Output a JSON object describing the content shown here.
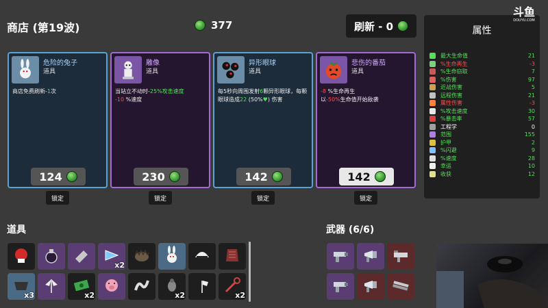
{
  "header": {
    "shop_title": "商店 (第19波)",
    "materials": "377",
    "reroll_label": "刷新 - 0"
  },
  "logo": {
    "mark": "斗鱼",
    "text": "DOUYU.COM"
  },
  "shop_items": [
    {
      "name": "危险的兔子",
      "type": "道具",
      "desc_parts": [
        [
          "商店免费刷新-",
          ""
        ],
        [
          "1",
          "g"
        ],
        [
          "次",
          ""
        ]
      ],
      "price": "124",
      "icon": "rabbit-icon",
      "rarity": "blue"
    },
    {
      "name": "雕像",
      "type": "道具",
      "desc_parts": [
        [
          "当站立不动时-",
          ""
        ],
        [
          "25%攻击速度",
          "g"
        ],
        [
          "\n",
          ""
        ],
        [
          "-10",
          "r"
        ],
        [
          " %速度",
          ""
        ]
      ],
      "price": "230",
      "icon": "statue-icon",
      "rarity": "purple"
    },
    {
      "name": "异形眼球",
      "type": "道具",
      "desc_parts": [
        [
          "每5秒向周围发射",
          ""
        ],
        [
          "6",
          "g"
        ],
        [
          "颗异形眼球，每颗眼球造成",
          ""
        ],
        [
          "22",
          "g"
        ],
        [
          " (50%",
          ""
        ],
        [
          "♥",
          "g"
        ],
        [
          ") 伤害",
          ""
        ]
      ],
      "price": "142",
      "icon": "alien-eyes-icon",
      "rarity": "blue"
    },
    {
      "name": "悲伤的番茄",
      "type": "道具",
      "desc_parts": [
        [
          "-8",
          "r"
        ],
        [
          " %生命再生\n以",
          ""
        ],
        [
          "-50%",
          "r"
        ],
        [
          "生命值开始敌袭",
          ""
        ]
      ],
      "price": "142",
      "icon": "sad-tomato-icon",
      "rarity": "purple",
      "selected": true
    }
  ],
  "lock_label": "锁定",
  "stats": {
    "title": "属性",
    "rows": [
      {
        "label": "最大生命值",
        "value": "21",
        "color": "#55e05a",
        "icon_color": "#55e05a"
      },
      {
        "label": "%生命再生",
        "value": "-3",
        "color": "#ff4d4d",
        "icon_color": "#7cd17c"
      },
      {
        "label": "%生命窃取",
        "value": "7",
        "color": "#55e05a",
        "icon_color": "#c85a5a"
      },
      {
        "label": "%伤害",
        "value": "97",
        "color": "#55e05a",
        "icon_color": "#e06060"
      },
      {
        "label": "近战伤害",
        "value": "5",
        "color": "#55e05a",
        "icon_color": "#d0a050"
      },
      {
        "label": "远程伤害",
        "value": "21",
        "color": "#55e05a",
        "icon_color": "#c0c0c0"
      },
      {
        "label": "属性伤害",
        "value": "-3",
        "color": "#ff4d4d",
        "icon_color": "#ff8040"
      },
      {
        "label": "%攻击速度",
        "value": "30",
        "color": "#55e05a",
        "icon_color": "#e8e8e8"
      },
      {
        "label": "%暴击率",
        "value": "57",
        "color": "#55e05a",
        "icon_color": "#e04040"
      },
      {
        "label": "工程学",
        "value": "0",
        "color": "#ffffff",
        "icon_color": "#a0a0a0"
      },
      {
        "label": "范围",
        "value": "155",
        "color": "#55e05a",
        "icon_color": "#b080e0"
      },
      {
        "label": "护甲",
        "value": "2",
        "color": "#55e05a",
        "icon_color": "#e0c040"
      },
      {
        "label": "%闪避",
        "value": "9",
        "color": "#55e05a",
        "icon_color": "#80c0ff"
      },
      {
        "label": "%速度",
        "value": "28",
        "color": "#55e05a",
        "icon_color": "#e0e0e0"
      },
      {
        "label": "幸运",
        "value": "10",
        "color": "#55e05a",
        "icon_color": "#f0f0f0"
      },
      {
        "label": "收获",
        "value": "12",
        "color": "#55e05a",
        "icon_color": "#e0e090"
      }
    ]
  },
  "inventory": {
    "title": "道具",
    "items": [
      {
        "icon": "boxing-glove-icon",
        "rarity": "dark",
        "qty": ""
      },
      {
        "icon": "potion-icon",
        "rarity": "purple",
        "qty": ""
      },
      {
        "icon": "eraser-icon",
        "rarity": "purple",
        "qty": ""
      },
      {
        "icon": "triangle-icon",
        "rarity": "purple",
        "qty": "x2"
      },
      {
        "icon": "hedgehog-icon",
        "rarity": "dark",
        "qty": ""
      },
      {
        "icon": "rabbit-icon",
        "rarity": "blue",
        "qty": ""
      },
      {
        "icon": "helmet-icon",
        "rarity": "dark",
        "qty": ""
      },
      {
        "icon": "armor-icon",
        "rarity": "dark",
        "qty": ""
      },
      {
        "icon": "cloth-icon",
        "rarity": "blue",
        "qty": "x3"
      },
      {
        "icon": "axe-wings-icon",
        "rarity": "purple",
        "qty": ""
      },
      {
        "icon": "banknote-icon",
        "rarity": "dark",
        "qty": "x2"
      },
      {
        "icon": "pig-icon",
        "rarity": "purple",
        "qty": ""
      },
      {
        "icon": "worm-icon",
        "rarity": "dark",
        "qty": ""
      },
      {
        "icon": "bug-icon",
        "rarity": "dark",
        "qty": "x2"
      },
      {
        "icon": "hatchet-icon",
        "rarity": "dark",
        "qty": ""
      },
      {
        "icon": "tool-icon",
        "rarity": "dark",
        "qty": "x2"
      }
    ]
  },
  "weapons": {
    "title": "武器 (6/6)",
    "items": [
      {
        "icon": "gun-icon",
        "rarity": "purple"
      },
      {
        "icon": "megaphone-gun-icon",
        "rarity": "purple"
      },
      {
        "icon": "turret-gun-icon",
        "rarity": "red"
      },
      {
        "icon": "gun-icon",
        "rarity": "purple"
      },
      {
        "icon": "megaphone-gun-icon",
        "rarity": "red"
      },
      {
        "icon": "shotgun-icon",
        "rarity": "red"
      }
    ]
  }
}
